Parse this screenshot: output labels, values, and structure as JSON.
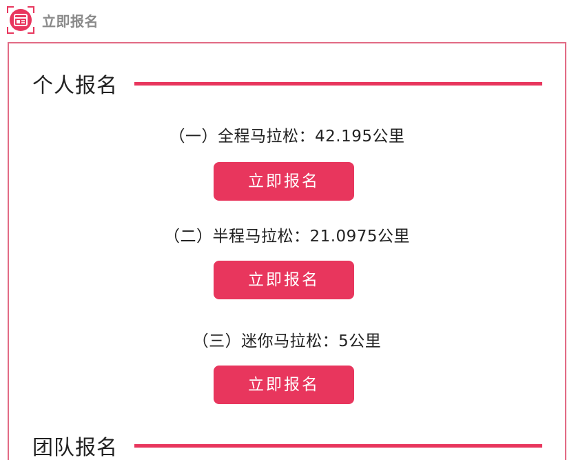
{
  "header": {
    "title": "立即报名",
    "icon": "registration-form-icon"
  },
  "individual": {
    "title": "个人报名",
    "races": [
      {
        "label": "（一）全程马拉松：42.195公里",
        "button": "立即报名"
      },
      {
        "label": "（二）半程马拉松：21.0975公里",
        "button": "立即报名"
      },
      {
        "label": "（三）迷你马拉松：5公里",
        "button": "立即报名"
      }
    ]
  },
  "team": {
    "title": "团队报名"
  },
  "colors": {
    "accent": "#e8365d",
    "panel_border": "#e26a84",
    "header_text": "#8a8a8a",
    "body_text": "#222222"
  }
}
